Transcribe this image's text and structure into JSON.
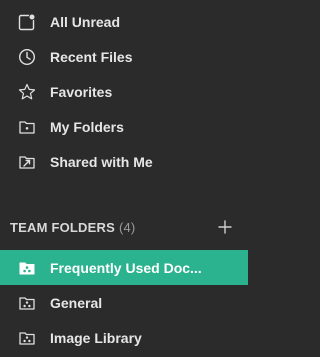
{
  "nav": {
    "items": [
      {
        "label": "All Unread",
        "icon": "all-unread-icon"
      },
      {
        "label": "Recent Files",
        "icon": "clock-icon"
      },
      {
        "label": "Favorites",
        "icon": "star-icon"
      },
      {
        "label": "My Folders",
        "icon": "folder-icon"
      },
      {
        "label": "Shared with Me",
        "icon": "shared-folder-icon"
      }
    ]
  },
  "team_folders": {
    "title": "TEAM FOLDERS",
    "count": "(4)",
    "add_icon": "plus-icon",
    "items": [
      {
        "label": "Frequently Used Doc...",
        "icon": "team-folder-icon",
        "active": true
      },
      {
        "label": "General",
        "icon": "team-folder-icon",
        "active": false
      },
      {
        "label": "Image Library",
        "icon": "team-folder-icon",
        "active": false
      }
    ]
  },
  "colors": {
    "background": "#2b2b2b",
    "active": "#2bb38f",
    "text": "#e6e6e6",
    "muted": "#9a9a9a"
  }
}
